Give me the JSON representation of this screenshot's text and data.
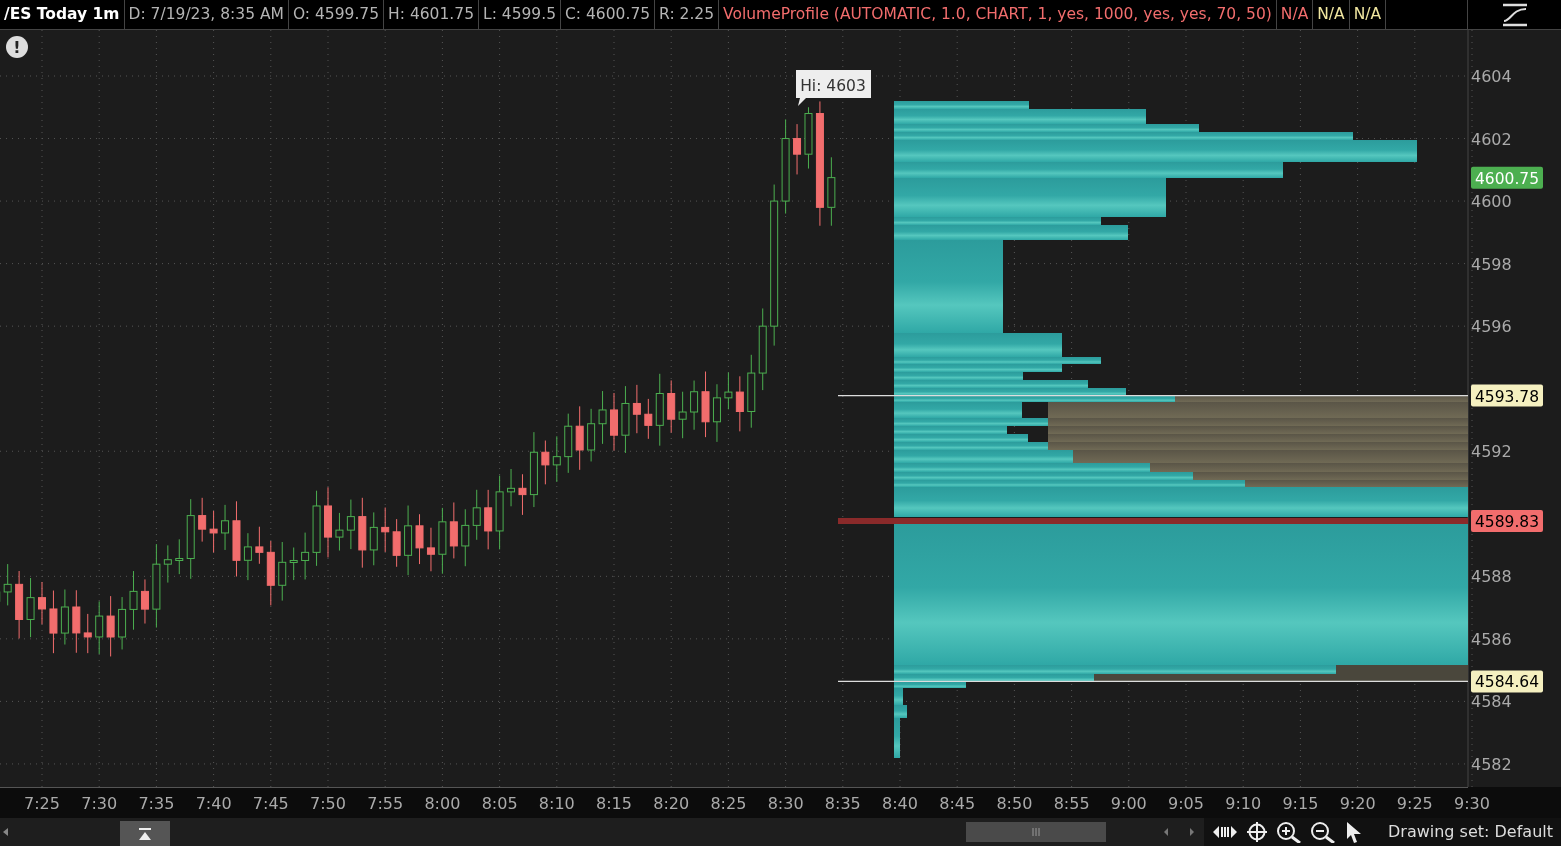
{
  "header": {
    "symbol": "/ES Today 1m",
    "fields": [
      {
        "text": "D: 7/19/23, 8:35 AM"
      },
      {
        "text": "O: 4599.75"
      },
      {
        "text": "H: 4601.75"
      },
      {
        "text": "L: 4599.5"
      },
      {
        "text": "C: 4600.75"
      },
      {
        "text": "R: 2.25"
      }
    ],
    "study": "VolumeProfile (AUTOMATIC, 1.0, CHART, 1, yes, 1000, yes, yes, 70, 50)",
    "study_values": [
      {
        "text": "N/A",
        "color": "#f26d6d"
      },
      {
        "text": "N/A",
        "color": "#f0e6a0"
      },
      {
        "text": "N/A",
        "color": "#f0e6a0"
      }
    ]
  },
  "chart": {
    "alert": "!",
    "tooltip": "Hi: 4603",
    "y_labels": [
      "4604",
      "4602",
      "4600",
      "4598",
      "4596",
      "4592",
      "4588",
      "4586",
      "4584",
      "4582"
    ],
    "price_markers": [
      {
        "text": "4600.75",
        "color": "#4caf50"
      },
      {
        "text": "4593.78",
        "color": "#f5f0c0"
      },
      {
        "text": "4589.83",
        "color": "#f26d6d"
      },
      {
        "text": "4584.64",
        "color": "#f5f0c0"
      }
    ],
    "x_labels": [
      "7:25",
      "7:30",
      "7:35",
      "7:40",
      "7:45",
      "7:50",
      "7:55",
      "8:00",
      "8:05",
      "8:10",
      "8:15",
      "8:20",
      "8:25",
      "8:30",
      "8:35",
      "8:40",
      "8:45",
      "8:50",
      "8:55",
      "9:00",
      "9:05",
      "9:10",
      "9:15",
      "9:20",
      "9:25",
      "9:30"
    ]
  },
  "toolbar": {
    "drawing_set": "Drawing set: Default"
  }
}
